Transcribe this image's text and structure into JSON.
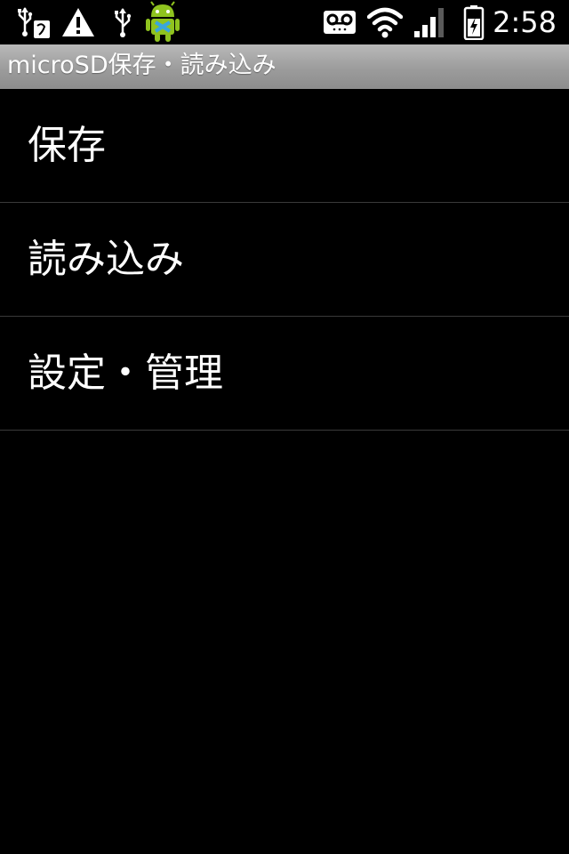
{
  "status_bar": {
    "icons": [
      "usb-debug-icon",
      "warning-icon",
      "usb-icon",
      "android-notification-icon",
      "voicemail-icon",
      "wifi-icon",
      "signal-icon",
      "battery-charging-icon"
    ],
    "time": "2:58"
  },
  "app": {
    "title": "microSD保存・読み込み"
  },
  "menu": {
    "items": [
      {
        "label": "保存"
      },
      {
        "label": "読み込み"
      },
      {
        "label": "設定・管理"
      }
    ]
  }
}
